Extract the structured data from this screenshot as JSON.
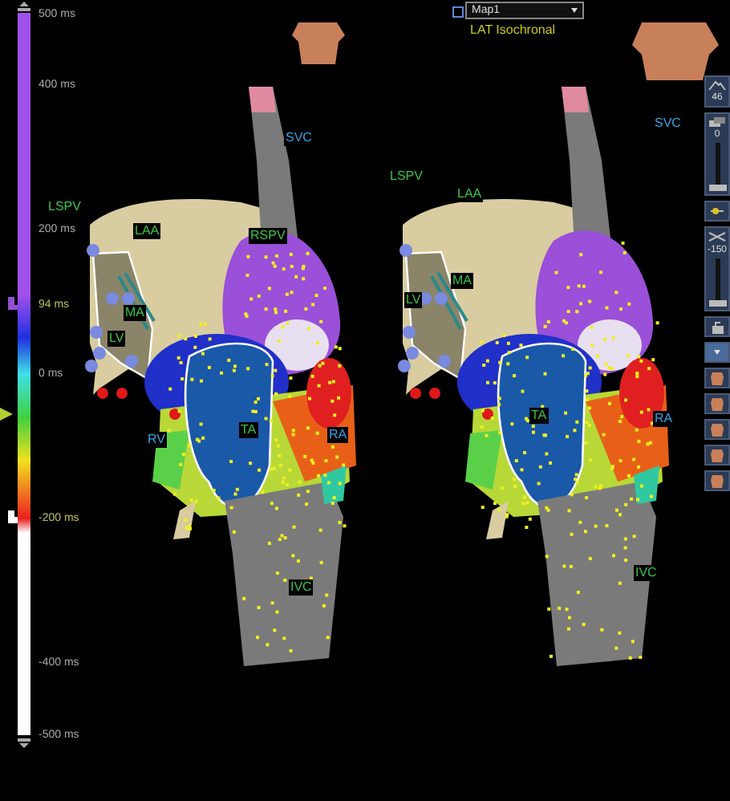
{
  "scale": {
    "ticks": [
      {
        "label": "500 ms",
        "kind": "tick"
      },
      {
        "label": "400 ms",
        "kind": "tick"
      },
      {
        "label": "200 ms",
        "kind": "tick"
      },
      {
        "label": "94 ms",
        "kind": "threshold"
      },
      {
        "label": "0 ms",
        "kind": "tick"
      },
      {
        "label": "-200 ms",
        "kind": "threshold"
      },
      {
        "label": "-400 ms",
        "kind": "tick"
      },
      {
        "label": "-500 ms",
        "kind": "tick"
      }
    ]
  },
  "map_selector": {
    "value": "Map1"
  },
  "map_type": "LAT Isochronal",
  "views": [
    {
      "labels": [
        {
          "text": "LSPV",
          "kind": "normal"
        },
        {
          "text": "LAA",
          "kind": "normal"
        },
        {
          "text": "SVC",
          "kind": "highlighted"
        },
        {
          "text": "RSPV",
          "kind": "normal"
        },
        {
          "text": "MA",
          "kind": "normal"
        },
        {
          "text": "LV",
          "kind": "normal"
        },
        {
          "text": "RV",
          "kind": "highlighted"
        },
        {
          "text": "TA",
          "kind": "normal"
        },
        {
          "text": "RA",
          "kind": "highlighted"
        },
        {
          "text": "IVC",
          "kind": "normal"
        }
      ]
    },
    {
      "labels": [
        {
          "text": "SVC",
          "kind": "highlighted"
        },
        {
          "text": "LSPV",
          "kind": "normal"
        },
        {
          "text": "LAA",
          "kind": "normal"
        },
        {
          "text": "MA",
          "kind": "normal"
        },
        {
          "text": "LV",
          "kind": "normal"
        },
        {
          "text": "TA",
          "kind": "normal"
        },
        {
          "text": "RA",
          "kind": "highlighted"
        },
        {
          "text": "IVC",
          "kind": "normal"
        }
      ]
    }
  ],
  "toolbar": {
    "fill_threshold": "46",
    "opacity": {
      "value": "0",
      "level": 0
    },
    "clipping": {
      "value": "-150",
      "level": 0
    },
    "view_buttons": [
      {
        "selected": true
      },
      {
        "selected": false
      },
      {
        "selected": false
      },
      {
        "selected": false
      },
      {
        "selected": false
      },
      {
        "selected": false
      }
    ]
  }
}
